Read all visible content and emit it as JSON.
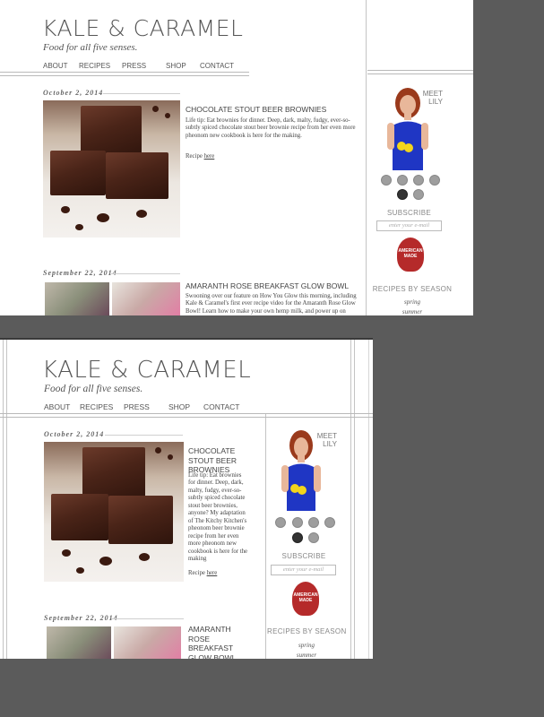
{
  "site": {
    "logo": "KALE & CARAMEL",
    "tagline": "Food for all five senses.",
    "nav": [
      "ABOUT",
      "RECIPES",
      "PRESS",
      "SHOP",
      "CONTACT"
    ]
  },
  "post1": {
    "date": "October 2, 2014",
    "title": "CHOCOLATE STOUT BEER BROWNIES",
    "body_wide": "Life tip: Eat brownies for dinner. Deep, dark, malty, fudgy, ever-so-subtly spiced chocolate stout beer brownie recipe from her even more pheonom new cookbook is here for the making.",
    "body_narrow": "Life tip: Eat brownies for dinner. Deep, dark, malty, fudgy, ever-so-subtly spiced chocolate stout beer brownies, anyone? My adaptation of The Kitchy Kitchen's pheonom beer brownie recipe from her even more pheonom new cookbook is here for the making",
    "recipe_prefix": "Recipe",
    "recipe_link": "here"
  },
  "post2": {
    "date": "September 22, 2014",
    "title": "AMARANTH ROSE BREAKFAST GLOW BOWL",
    "body": "Swooning over our feature on How You Glow this morning, including Kale & Caramel's first ever recipe video for the Amaranth Rose Glow Bowl! Learn how to make your own hemp milk, and power up on"
  },
  "sidebar": {
    "meet_line1": "MEET",
    "meet_line2": "LILY",
    "social_icons": [
      "email-icon",
      "facebook-icon",
      "pinterest-icon",
      "instagram-icon",
      "twitter-icon",
      "mail-icon"
    ],
    "subscribe_title": "SUBSCRIBE",
    "email_placeholder": "enter your e-mail",
    "badge_text": "AMERICAN MADE",
    "badge_color": "#b52a2a",
    "recipes_title": "RECIPES BY SEASON",
    "seasons": [
      "spring",
      "summer"
    ]
  }
}
